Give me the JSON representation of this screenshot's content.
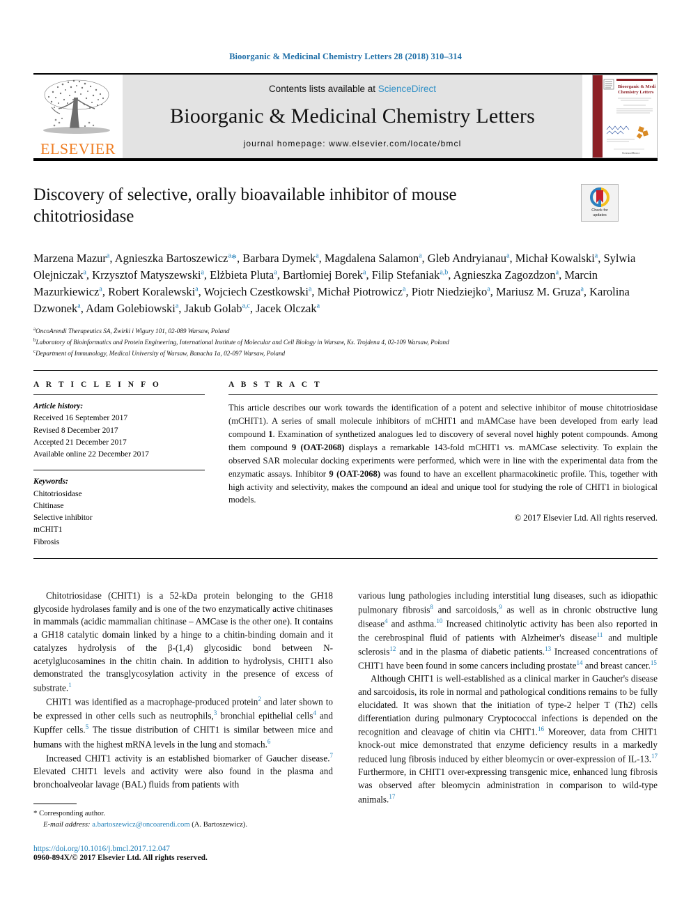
{
  "running_head": "Bioorganic & Medicinal Chemistry Letters 28 (2018) 310–314",
  "masthead": {
    "contents_prefix": "Contents lists available at ",
    "sciencedirect": "ScienceDirect",
    "journal_name": "Bioorganic & Medicinal Chemistry Letters",
    "homepage": "journal homepage: www.elsevier.com/locate/bmcl",
    "publisher_wordmark": "ELSEVIER",
    "cover_title_line1": "Bioorganic & Medicinal",
    "cover_title_line2": "Chemistry Letters"
  },
  "colors": {
    "link_blue": "#1f7fb8",
    "sciencedirect_blue": "#2e8fc6",
    "elsevier_orange": "#ef7d22",
    "masthead_gray": "#e3e3e3",
    "crossmark_red": "#c8202c",
    "crossmark_yellow": "#f4c020",
    "crossmark_blue": "#2a7fc1"
  },
  "title": "Discovery of selective, orally bioavailable inhibitor of mouse chitotriosidase",
  "crossmark": {
    "caption_line1": "Check for",
    "caption_line2": "updates"
  },
  "authors_html": "Marzena Mazur<sup>a</sup>, Agnieszka Bartoszewicz<sup>a</sup><span class=\"star\">*</span>, Barbara Dymek<sup>a</sup>, Magdalena Salamon<sup>a</sup>, Gleb Andryianau<sup>a</sup>, Michał Kowalski<sup>a</sup>, Sylwia Olejniczak<sup>a</sup>, Krzysztof Matyszewski<sup>a</sup>, Elżbieta Pluta<sup>a</sup>, Bartłomiej Borek<sup>a</sup>, Filip Stefaniak<sup>a,b</sup>, Agnieszka Zagozdzon<sup>a</sup>, Marcin Mazurkiewicz<sup>a</sup>, Robert Koralewski<sup>a</sup>, Wojciech Czestkowski<sup>a</sup>, Michał Piotrowicz<sup>a</sup>, Piotr Niedziejko<sup>a</sup>, Mariusz M. Gruza<sup>a</sup>, Karolina Dzwonek<sup>a</sup>, Adam Golebiowski<sup>a</sup>, Jakub Golab<sup>a,c</sup>, Jacek Olczak<sup>a</sup>",
  "affiliations": [
    {
      "mark": "a",
      "text": "OncoArendi Therapeutics SA, Żwirki i Wigury 101, 02-089 Warsaw, Poland"
    },
    {
      "mark": "b",
      "text": "Laboratory of Bioinformatics and Protein Engineering, International Institute of Molecular and Cell Biology in Warsaw, Ks. Trojdena 4, 02-109 Warsaw, Poland"
    },
    {
      "mark": "c",
      "text": "Department of Immunology, Medical University of Warsaw, Banacha 1a, 02-097 Warsaw, Poland"
    }
  ],
  "article_info": {
    "heading": "A R T I C L E   I N F O",
    "history_label": "Article history:",
    "history": [
      "Received 16 September 2017",
      "Revised 8 December 2017",
      "Accepted 21 December 2017",
      "Available online 22 December 2017"
    ],
    "keywords_label": "Keywords:",
    "keywords": [
      "Chitotriosidase",
      "Chitinase",
      "Selective inhibitor",
      "mCHIT1",
      "Fibrosis"
    ]
  },
  "abstract": {
    "heading": "A B S T R A C T",
    "text_html": "This article describes our work towards the identification of a potent and selective inhibitor of mouse chitotriosidase (mCHIT1). A series of small molecule inhibitors of mCHIT1 and mAMCase have been developed from early lead compound <b>1</b>. Examination of synthetized analogues led to discovery of several novel highly potent compounds. Among them compound <b>9 (OAT-2068)</b> displays a remarkable 143-fold mCHIT1 vs. mAMCase selectivity. To explain the observed SAR molecular docking experiments were performed, which were in line with the experimental data from the enzymatic assays. Inhibitor <b>9 (OAT-2068)</b> was found to have an excellent pharmacokinetic profile. This, together with high activity and selectivity, makes the compound an ideal and unique tool for studying the role of CHIT1 in biological models.",
    "copyright": "© 2017 Elsevier Ltd. All rights reserved."
  },
  "body": {
    "left_paragraphs_html": [
      "Chitotriosidase (CHIT1) is a 52-kDa protein belonging to the GH18 glycoside hydrolases family and is one of the two enzymatically active chitinases in mammals (acidic mammalian chitinase – AMCase is the other one). It contains a GH18 catalytic domain linked by a hinge to a chitin-binding domain and it catalyzes hydrolysis of the β-(1,4) glycosidic bond between N-acetylglucosamines in the chitin chain. In addition to hydrolysis, CHIT1 also demonstrated the transglycosylation activity in the presence of excess of substrate.<sup>1</sup>",
      "CHIT1 was identified as a macrophage-produced protein<sup>2</sup> and later shown to be expressed in other cells such as neutrophils,<sup>3</sup> bronchial epithelial cells<sup>4</sup> and Kupffer cells.<sup>5</sup> The tissue distribution of CHIT1 is similar between mice and humans with the highest mRNA levels in the lung and stomach.<sup>6</sup>",
      "Increased CHIT1 activity is an established biomarker of Gaucher disease.<sup>7</sup> Elevated CHIT1 levels and activity were also found in the plasma and bronchoalveolar lavage (BAL) fluids from patients with"
    ],
    "right_paragraphs_html": [
      "various lung pathologies including interstitial lung diseases, such as idiopathic pulmonary fibrosis<sup>8</sup> and sarcoidosis,<sup>9</sup> as well as in chronic obstructive lung disease<sup>4</sup> and asthma.<sup>10</sup> Increased chitinolytic activity has been also reported in the cerebrospinal fluid of patients with Alzheimer's disease<sup>11</sup> and multiple sclerosis<sup>12</sup> and in the plasma of diabetic patients.<sup>13</sup> Increased concentrations of CHIT1 have been found in some cancers including prostate<sup>14</sup> and breast cancer.<sup>15</sup>",
      "Although CHIT1 is well-established as a clinical marker in Gaucher's disease and sarcoidosis, its role in normal and pathological conditions remains to be fully elucidated. It was shown that the initiation of type-2 helper T (Th2) cells differentiation during pulmonary Cryptococcal infections is depended on the recognition and cleavage of chitin via CHIT1.<sup>16</sup> Moreover, data from CHIT1 knock-out mice demonstrated that enzyme deficiency results in a markedly reduced lung fibrosis induced by either bleomycin or over-expression of IL-13.<sup>17</sup> Furthermore, in CHIT1 over-expressing transgenic mice, enhanced lung fibrosis was observed after bleomycin administration in comparison to wild-type animals.<sup>17</sup>"
    ],
    "right_first_indent": false
  },
  "footnote": {
    "star": "*",
    "corresponding": "Corresponding author.",
    "email_label": "E-mail address:",
    "email": "a.bartoszewicz@oncoarendi.com",
    "email_suffix": "(A. Bartoszewicz)."
  },
  "footer": {
    "doi": "https://doi.org/10.1016/j.bmcl.2017.12.047",
    "issn_line": "0960-894X/© 2017 Elsevier Ltd. All rights reserved."
  }
}
